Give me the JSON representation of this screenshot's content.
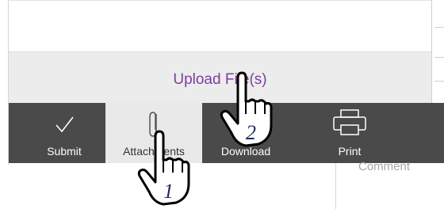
{
  "upload": {
    "label": "Upload File(s)"
  },
  "toolbar": {
    "items": [
      {
        "label": "Submit",
        "icon": "checkmark-icon"
      },
      {
        "label": "Attachments",
        "icon": "paperclip-icon"
      },
      {
        "label": "Download",
        "icon": "download-icon"
      },
      {
        "label": "Print",
        "icon": "printer-icon"
      }
    ]
  },
  "comment": {
    "placeholder": "Comment"
  },
  "annotations": {
    "step1": "1",
    "step2": "2"
  },
  "colors": {
    "toolbar_bg": "#4a4a4a",
    "upload_bg": "#ececec",
    "upload_text": "#7b3fa0",
    "active_tool_bg": "#e9e9e9"
  }
}
